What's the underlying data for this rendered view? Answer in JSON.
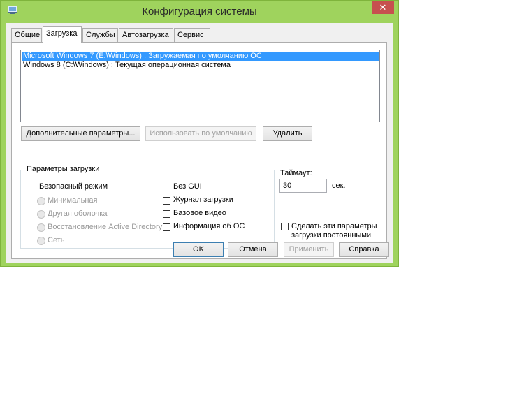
{
  "window": {
    "title": "Конфигурация системы",
    "close_glyph": "✕"
  },
  "tabs": [
    {
      "label": "Общие",
      "active": false
    },
    {
      "label": "Загрузка",
      "active": true
    },
    {
      "label": "Службы",
      "active": false
    },
    {
      "label": "Автозагрузка",
      "active": false
    },
    {
      "label": "Сервис",
      "active": false
    }
  ],
  "boot_entries": [
    {
      "text": "Microsoft Windows 7 (E:\\Windows) : Загружаемая по умолчанию ОС",
      "selected": true
    },
    {
      "text": "Windows 8 (C:\\Windows) : Текущая операционная система",
      "selected": false
    }
  ],
  "entry_buttons": {
    "advanced": "Дополнительные параметры...",
    "set_default": "Использовать по умолчанию",
    "delete": "Удалить"
  },
  "boot_options": {
    "group_label": "Параметры загрузки",
    "safe_boot": {
      "label": "Безопасный режим",
      "checked": false
    },
    "safe_modes": [
      {
        "label": "Минимальная",
        "enabled": false
      },
      {
        "label": "Другая оболочка",
        "enabled": false
      },
      {
        "label": "Восстановление Active Directory",
        "enabled": false
      },
      {
        "label": "Сеть",
        "enabled": false
      }
    ],
    "flags": [
      {
        "label": "Без GUI",
        "checked": false
      },
      {
        "label": "Журнал загрузки",
        "checked": false
      },
      {
        "label": "Базовое видео",
        "checked": false
      },
      {
        "label": "Информация  об ОС",
        "checked": false
      }
    ]
  },
  "timeout": {
    "label": "Таймаут:",
    "value": "30",
    "unit": "сек."
  },
  "permanent": {
    "label_line1": "Сделать эти параметры",
    "label_line2": "загрузки постоянными",
    "checked": false
  },
  "dialog_buttons": {
    "ok": "OK",
    "cancel": "Отмена",
    "apply": "Применить",
    "help": "Справка"
  },
  "colors": {
    "frame": "#9fd35d",
    "close": "#c7504f",
    "selection": "#3399ff"
  }
}
